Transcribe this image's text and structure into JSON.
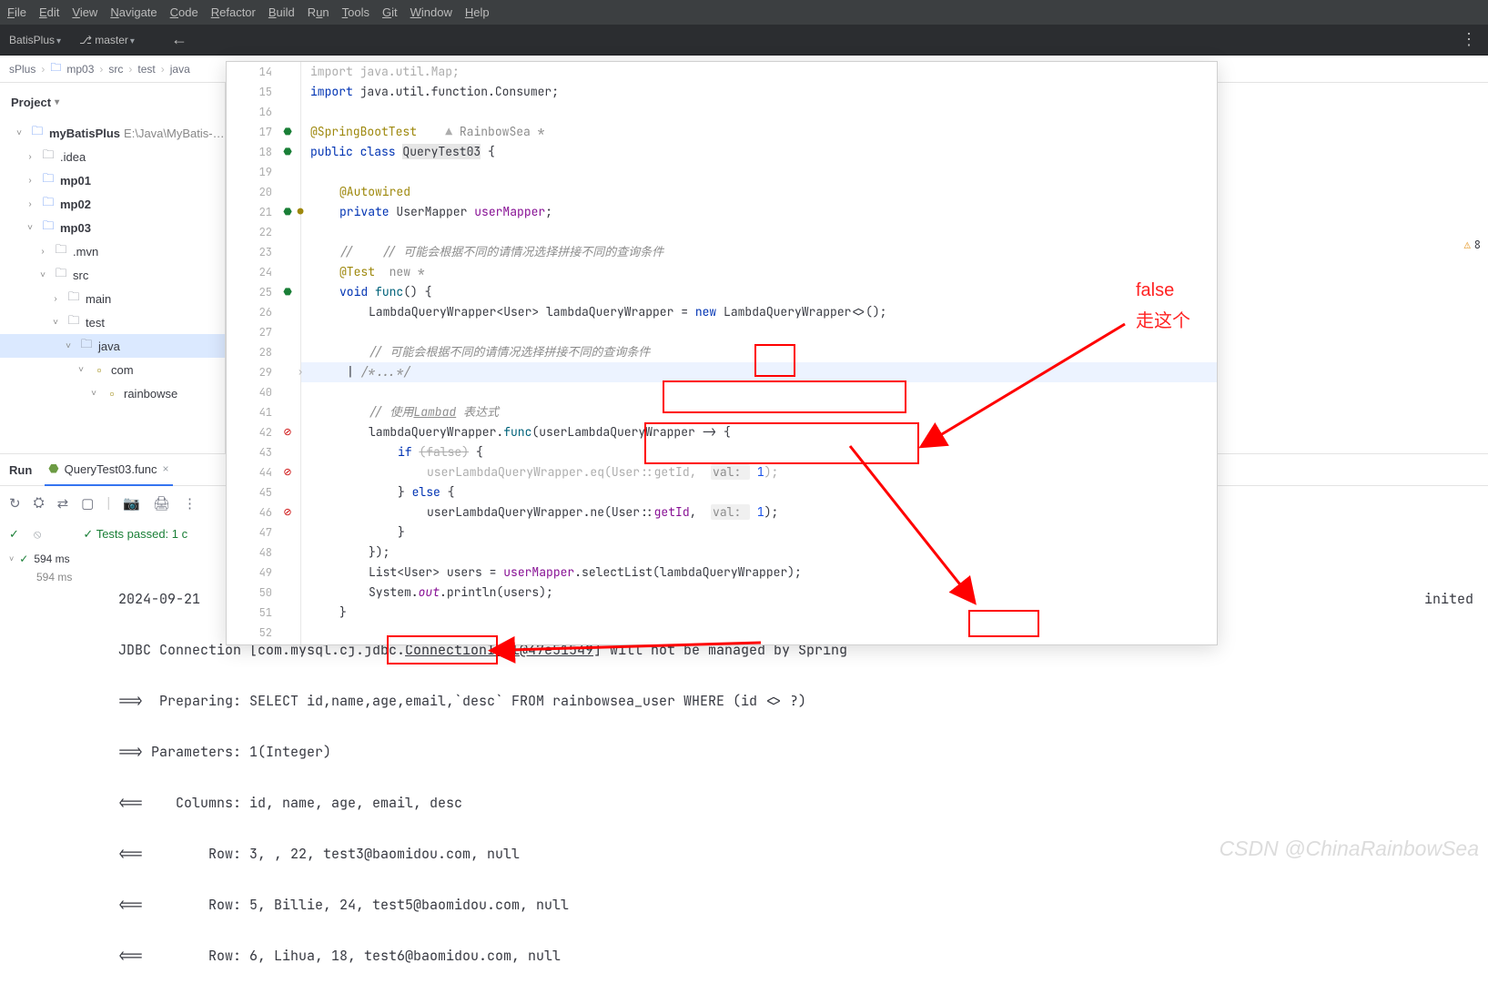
{
  "menubar": {
    "file": "File",
    "edit": "Edit",
    "view": "View",
    "navigate": "Navigate",
    "code": "Code",
    "refactor": "Refactor",
    "build": "Build",
    "run": "Run",
    "tools": "Tools",
    "git": "Git",
    "window": "Window",
    "help": "Help"
  },
  "toolbar": {
    "project": "BatisPlus",
    "branch_icon": "⎇",
    "branch": "master",
    "back": "←",
    "kebab": "⋮"
  },
  "breadcrumb": {
    "p0": "sPlus",
    "p1": "mp03",
    "p2": "src",
    "p3": "test",
    "p4": "java"
  },
  "project_panel": {
    "title": "Project"
  },
  "tree": {
    "root": "myBatisPlus",
    "root_path": "E:\\Java\\MyBatis-…",
    "idea": ".idea",
    "mp01": "mp01",
    "mp02": "mp02",
    "mp03": "mp03",
    "mvn": ".mvn",
    "src": "src",
    "main": "main",
    "test": "test",
    "java": "java",
    "com": "com",
    "rainbowse": "rainbowse"
  },
  "lint": {
    "warn_icon": "⚠",
    "warn_count": "8"
  },
  "code": {
    "l14": "import java.util.Map;",
    "l15_a": "import",
    "l15_b": " java.util.function.Consumer;",
    "l17_a": "@SpringBootTest",
    "l17_b": "RainbowSea *",
    "l18_a": "public class ",
    "l18_b": "QueryTest03",
    "l18_c": " {",
    "l20": "@Autowired",
    "l21_a": "private ",
    "l21_b": "UserMapper ",
    "l21_c": "userMapper",
    "l21_d": ";",
    "l23_a": "//    // 可能会根据不同的请情况选择拼接不同的查询条件",
    "l24_a": "@Test",
    "l24_b": "  new *",
    "l25_a": "void ",
    "l25_b": "func",
    "l25_c": "() {",
    "l26_a": "LambdaQueryWrapper<",
    "l26_b": "User",
    "l26_c": "> lambdaQueryWrapper = ",
    "l26_d": "new ",
    "l26_e": "LambdaQueryWrapper<>();",
    "l28": "// 可能会根据不同的请情况选择拼接不同的查询条件",
    "l29": "/*...*/",
    "l31": "// 使用Lambad 表达式",
    "l42_a": "lambdaQueryWrapper.",
    "l42_b": "func",
    "l42_c": "(userLambdaQueryWrapper -> {",
    "l43_a": "if ",
    "l43_b": "(false)",
    "l43_c": " {",
    "l44_a": "userLambdaQueryWrapper.eq(",
    "l44_b": "User",
    "l44_c": "::",
    "l44_d": "getId",
    "l44_e": ",  ",
    "l44_f": "val: ",
    "l44_g": "1",
    "l44_h": ");",
    "l45_a": "} ",
    "l45_b": "else ",
    "l45_c": "{",
    "l46_a": "userLambdaQueryWrapper.ne(",
    "l46_b": "User",
    "l46_c": "::",
    "l46_d": "getId",
    "l46_e": ",  ",
    "l46_f": "val: ",
    "l46_g": "1",
    "l46_h": ");",
    "l47": "}",
    "l48": "});",
    "l49_a": "List<",
    "l49_b": "User",
    "l49_c": "> users = ",
    "l49_d": "userMapper",
    "l49_e": ".selectList(lambdaQueryWrapper);",
    "l50_a": "System.",
    "l50_b": "out",
    "l50_c": ".println(users);",
    "l51": "}"
  },
  "run_panel": {
    "title": "Run",
    "tab": "QueryTest03.func",
    "close": "×"
  },
  "run_toolbar": {
    "i1": "↻",
    "i2": "⛭",
    "i3": "⇄",
    "i4": "▢",
    "sep": "|",
    "i5": "📷",
    "i6": "🖨",
    "i7": "⋮"
  },
  "run_status": {
    "tick1": "✓",
    "prohibit": "⦸",
    "tick2": "✓",
    "text": "Tests passed: 1 c"
  },
  "test_tree": {
    "arrow": "˅",
    "tick": "✓",
    "name": "594 ms",
    "time": "594 ms"
  },
  "console": {
    "r0_date": "2024-09-21  ",
    "r0_end": "inited",
    "r1": "JDBC Connection [com.mysql.cj.jdbc.ConnectionImpl@47e51549] will not be managed by Spring",
    "r2": "==>  Preparing: SELECT id,name,age,email,`desc` FROM rainbowsea_user WHERE (id <> ?)",
    "r3": "==> Parameters: 1(Integer)",
    "r4": "<==    Columns: id, name, age, email, desc",
    "r5": "<==        Row: 3, , 22, test3@baomidou.com, null",
    "r6": "<==        Row: 5, Billie, 24, test5@baomidou.com, null",
    "r7": "<==        Row: 6, Lihua, 18, test6@baomidou.com, null"
  },
  "annotations": {
    "false": "false",
    "text2": "走这个"
  },
  "watermark": "CSDN @ChinaRainbowSea"
}
